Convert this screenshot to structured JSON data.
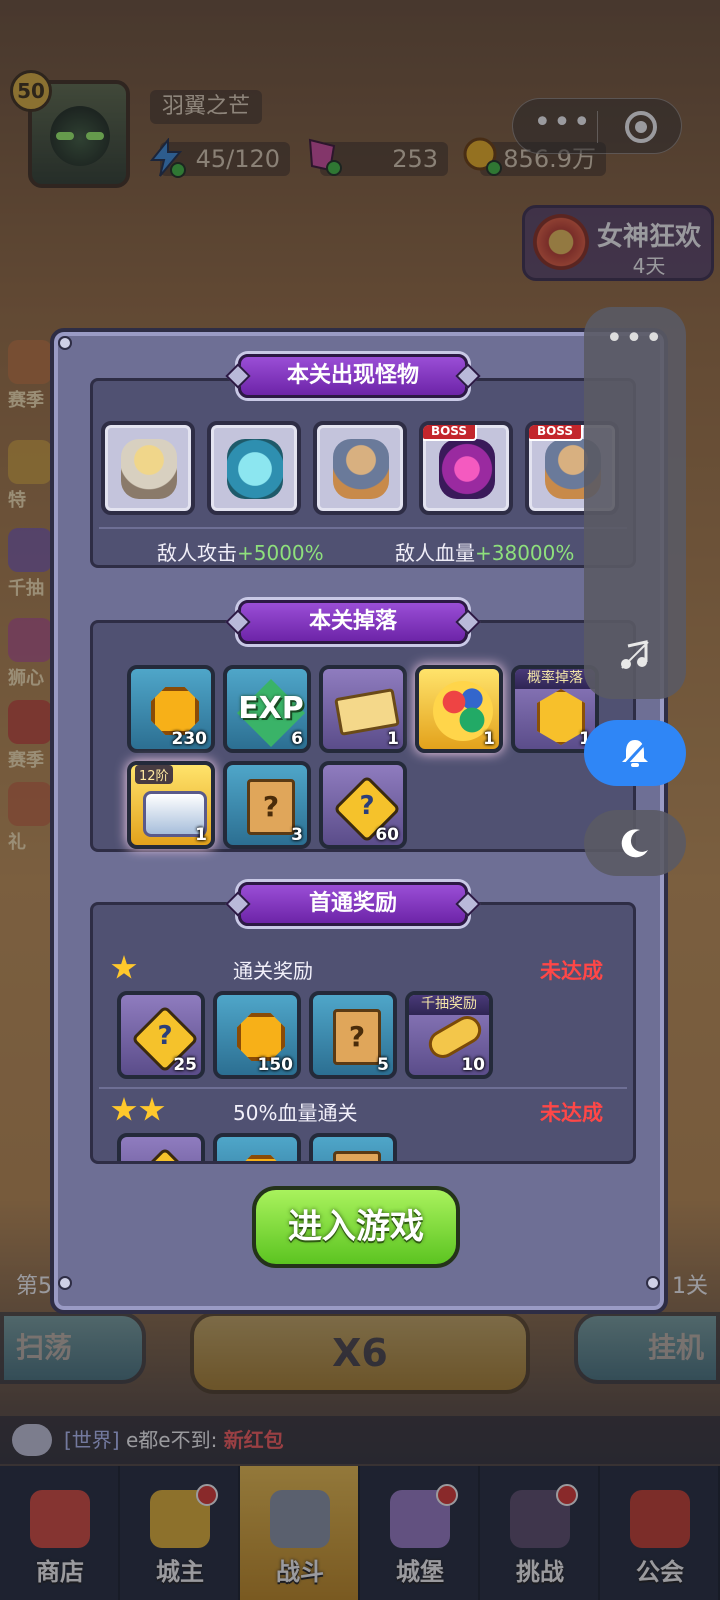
{
  "player": {
    "level": "50",
    "name": "羽翼之芒",
    "energy": "45/120",
    "gems": "253",
    "gold": "856.9万"
  },
  "event": {
    "title": "女神狂欢",
    "days": "4天"
  },
  "side_menu": [
    "赛季",
    "特",
    "千抽",
    "狮心",
    "赛季",
    "礼"
  ],
  "modal": {
    "monsters_title": "本关出现怪物",
    "boss_label": "BOSS",
    "enemy_attack_label": "敌人攻击",
    "enemy_attack_value": "+5000%",
    "enemy_hp_label": "敌人血量",
    "enemy_hp_value": "+38000%",
    "drops_title": "本关掉落",
    "drops": [
      {
        "icon": "gold-coin-icon",
        "count": "230"
      },
      {
        "icon": "exp-icon",
        "label": "EXP",
        "count": "6"
      },
      {
        "icon": "ticket-icon",
        "count": "1"
      },
      {
        "icon": "mystery-gem-bag-icon",
        "count": "1"
      },
      {
        "icon": "gold-badge-icon",
        "tag": "概率掉落",
        "count": "1"
      },
      {
        "icon": "chest-icon",
        "tag": "12阶",
        "count": "1"
      },
      {
        "icon": "scroll-icon",
        "count": "3"
      },
      {
        "icon": "puzzle-icon",
        "count": "60"
      }
    ],
    "first_clear_title": "首通奖励",
    "reward_row1_title": "通关奖励",
    "reward_row1_status": "未达成",
    "reward_row1_items": [
      {
        "icon": "puzzle-icon",
        "count": "25"
      },
      {
        "icon": "gold-coin-icon",
        "count": "150"
      },
      {
        "icon": "scroll-icon",
        "count": "5"
      },
      {
        "icon": "key-icon",
        "tag": "千抽奖励",
        "count": "10"
      }
    ],
    "reward_row2_title": "50%血量通关",
    "reward_row2_status": "未达成",
    "enter_button": "进入游戏"
  },
  "stage": {
    "left": "第5",
    "right": "1关"
  },
  "actions": {
    "sweep": "扫荡",
    "fight": "X6",
    "idle": "挂机"
  },
  "chat": {
    "channel": "[世界]",
    "sender": "e都e不到:",
    "message": "新红包"
  },
  "tabs": [
    {
      "label": "商店",
      "color": "#d9453a"
    },
    {
      "label": "城主",
      "color": "#e7b531",
      "badge": true
    },
    {
      "label": "战斗",
      "color": "#8b95a8",
      "active": true
    },
    {
      "label": "城堡",
      "color": "#9a7bc9",
      "badge": true
    },
    {
      "label": "挑战",
      "color": "#5a4a6a",
      "badge": true
    },
    {
      "label": "公会",
      "color": "#c83a2a"
    }
  ],
  "colors": {
    "accent_purple": "#7a34b8",
    "green_button": "#6ed42e",
    "unmet_red": "#ff4747",
    "bonus_green": "#8ee07c"
  }
}
